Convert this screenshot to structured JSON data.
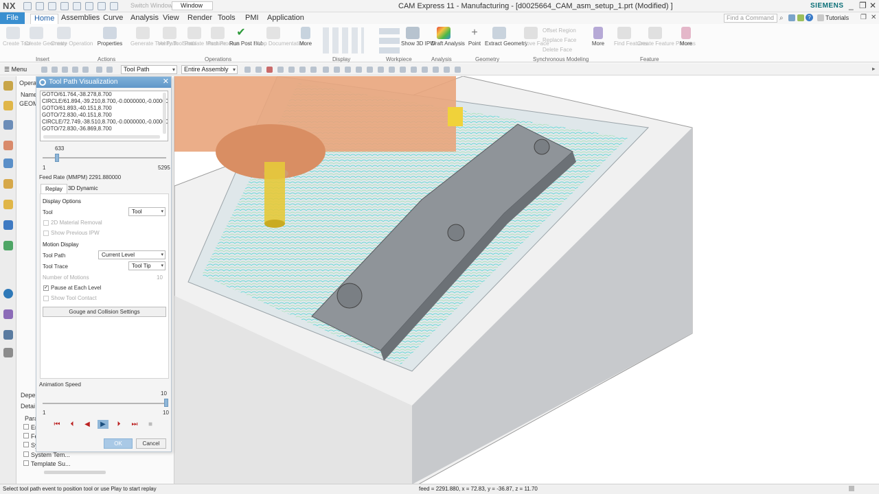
{
  "app": {
    "logo": "NX",
    "title": "CAM Express 11 - Manufacturing - [d0025664_CAM_asm_setup_1.prt (Modified) ]",
    "brand": "SIEMENS",
    "switch_window": "Switch Window",
    "window_menu": "Window",
    "search_placeholder": "Find a Command",
    "tutorials": "Tutorials"
  },
  "tabs": [
    "File",
    "Home",
    "Assemblies",
    "Curve",
    "Analysis",
    "View",
    "Render",
    "Tools",
    "PMI",
    "Application"
  ],
  "ribbon": {
    "insert": [
      "Create Tool",
      "Create Geometry",
      "Create Operation"
    ],
    "actions": [
      "Properties"
    ],
    "operations": [
      "Generate Tool Path",
      "Verify Tool Path",
      "Simulate Machine",
      "Post Process",
      "Run Post Hub",
      "Shop Documentation",
      "More"
    ],
    "display": [
      "Show 3D IPW"
    ],
    "analysis": [
      "Draft Analysis"
    ],
    "geometry": [
      "Point",
      "Extract Geometry"
    ],
    "sync": [
      "Offset Region",
      "Replace Face",
      "Delete Face",
      "Move Face",
      "More"
    ],
    "feature": [
      "Find Features",
      "Create Feature Process",
      "More"
    ],
    "groups": [
      "Insert",
      "Actions",
      "Operations",
      "Display",
      "Workpiece",
      "Analysis",
      "Geometry",
      "Synchronous Modeling",
      "Feature"
    ]
  },
  "toolbar2": {
    "menu": "Menu",
    "filter1": "Tool Path",
    "filter2": "Entire Assembly"
  },
  "navigator": {
    "header": "Operat",
    "col": "Name",
    "geom": "GEOM",
    "depend": "Depe",
    "details": "Detai",
    "params": "Para",
    "items": [
      "Er",
      "Fe",
      "Sy",
      "System Tem...",
      "Template Su..."
    ]
  },
  "dialog": {
    "title": "Tool Path Visualization",
    "goto_lines": [
      "GOTO/61.764,-38.278,8.700",
      "CIRCLE/61.894,-39.210,8.700,-0.0000000,-0.000000",
      "GOTO/61.893,-40.151,8.700",
      "GOTO/72.830,-40.151,8.700",
      "CIRCLE/72.749,-38.510,8.700,-0.0000000,-0.000000",
      "GOTO/72.830,-36.869,8.700"
    ],
    "position_value": "633",
    "slider_min": "1",
    "slider_max": "5295",
    "slider_fraction": 0.119,
    "feed_rate": "Feed Rate (MMPM) 2291.880000",
    "tab_replay": "Replay",
    "tab_3d": "3D Dynamic",
    "display_options": "Display Options",
    "tool_label": "Tool",
    "tool_value": "Tool",
    "material_removal": "2D Material Removal",
    "show_previous": "Show Previous IPW",
    "motion_display": "Motion Display",
    "tool_path_label": "Tool Path",
    "tool_path_value": "Current Level",
    "tool_trace_label": "Tool Trace",
    "tool_trace_value": "Tool Tip",
    "num_motions_label": "Number of Motions",
    "num_motions_value": "10",
    "pause_each_level": "Pause at Each Level",
    "show_tool_contact": "Show Tool Contact",
    "gouge_button": "Gouge and Collision Settings",
    "anim_speed": "Animation Speed",
    "speed_value": "10",
    "speed_min": "1",
    "speed_max": "10",
    "speed_fraction": 1.0,
    "ok": "OK",
    "cancel": "Cancel"
  },
  "status": {
    "left": "Select tool path event to position tool or use Play to start replay",
    "right": "feed = 2291.880, x = 72.83, y = -36.87, z = 11.70"
  },
  "colors": {
    "accent": "#3a8fd0",
    "dialog_title": "#6aa2d2",
    "toolpath": "#37d3cf",
    "part": "#8a8f94",
    "holder": "#e9a57c",
    "tool": "#e6c93a"
  }
}
